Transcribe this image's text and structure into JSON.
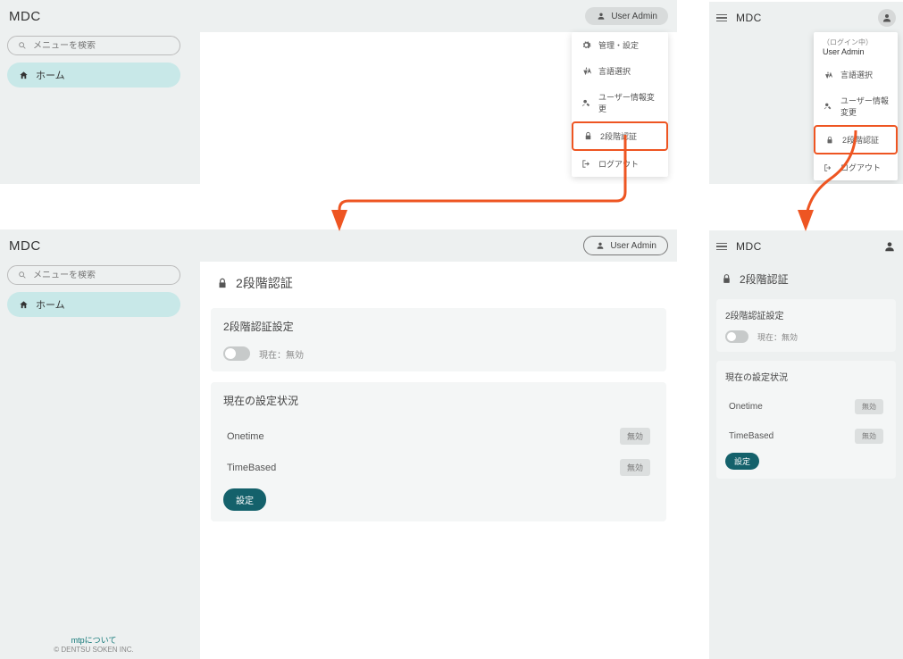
{
  "brand": "MDC",
  "user_label": "User Admin",
  "search_placeholder": "メニューを検索",
  "nav_home": "ホーム",
  "menu": {
    "admin": "管理・設定",
    "language": "言語選択",
    "userinfo": "ユーザー情報変更",
    "twofa": "2段階認証",
    "logout": "ログアウト",
    "login_status": "（ログイン中）",
    "login_name": "User Admin"
  },
  "page": {
    "title": "2段階認証",
    "settings_title": "2段階認証設定",
    "toggle_label": "現在：無効",
    "status_title": "現在の設定状況",
    "onetime": "Onetime",
    "timebased": "TimeBased",
    "disabled_badge": "無効",
    "config_btn": "設定"
  },
  "footer": {
    "link": "mtpについて",
    "copy": "© DENTSU SOKEN INC."
  }
}
